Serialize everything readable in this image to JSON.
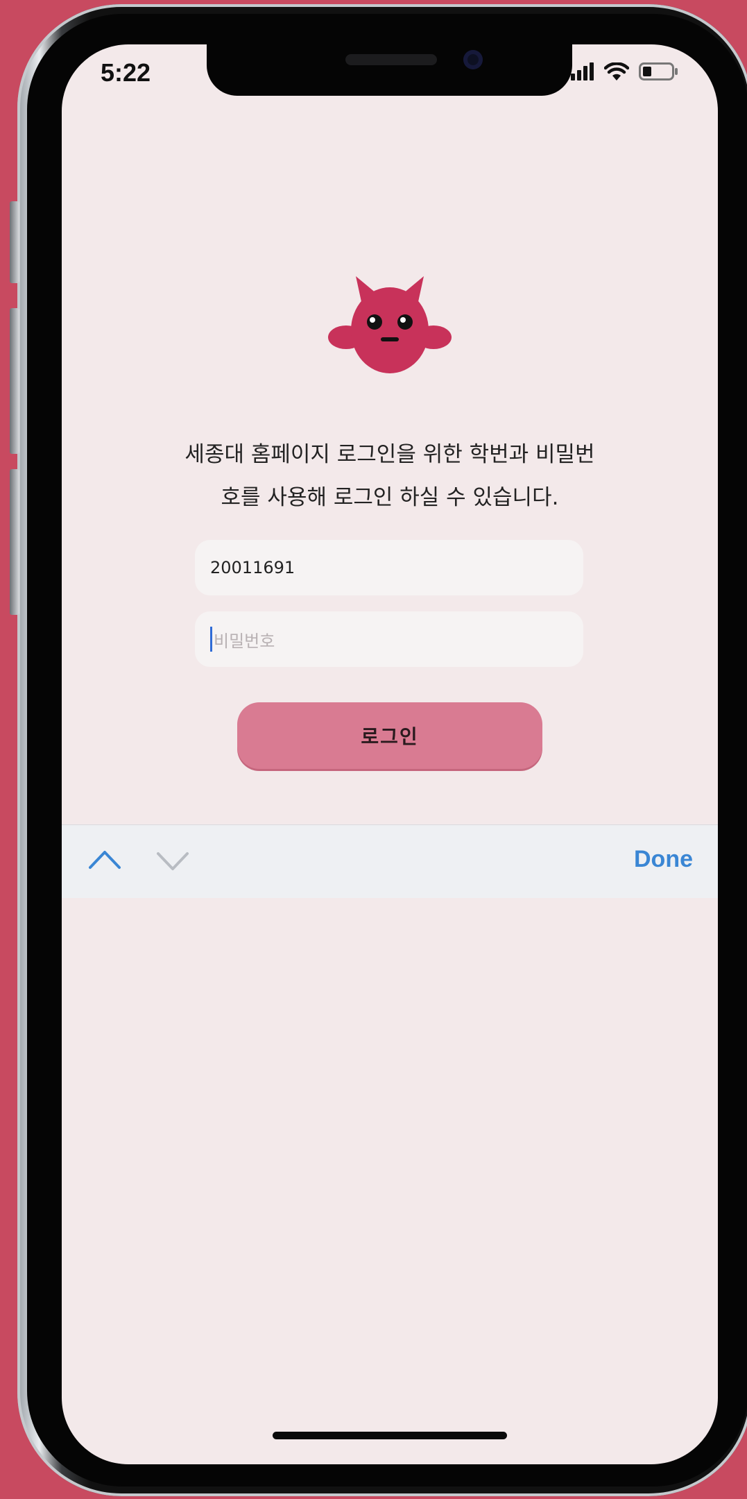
{
  "status_bar": {
    "time": "5:22"
  },
  "intro": {
    "line1": "세종대 홈페이지 로그인을 위한 학번과 비밀번",
    "line2": "호를 사용해 로그인 하실 수 있습니다."
  },
  "form": {
    "student_id_value": "20011691",
    "password_placeholder": "비밀번호",
    "login_label": "로그인"
  },
  "keyboard_toolbar": {
    "done_label": "Done"
  },
  "colors": {
    "background": "#c84a60",
    "screen": "#f3e9ea",
    "accent": "#c8325a",
    "button": "#d97b92",
    "done": "#3a86d4"
  },
  "icons": [
    "signal-icon",
    "wifi-icon",
    "battery-icon",
    "mascot-logo-icon",
    "chevron-up-icon",
    "chevron-down-icon"
  ]
}
